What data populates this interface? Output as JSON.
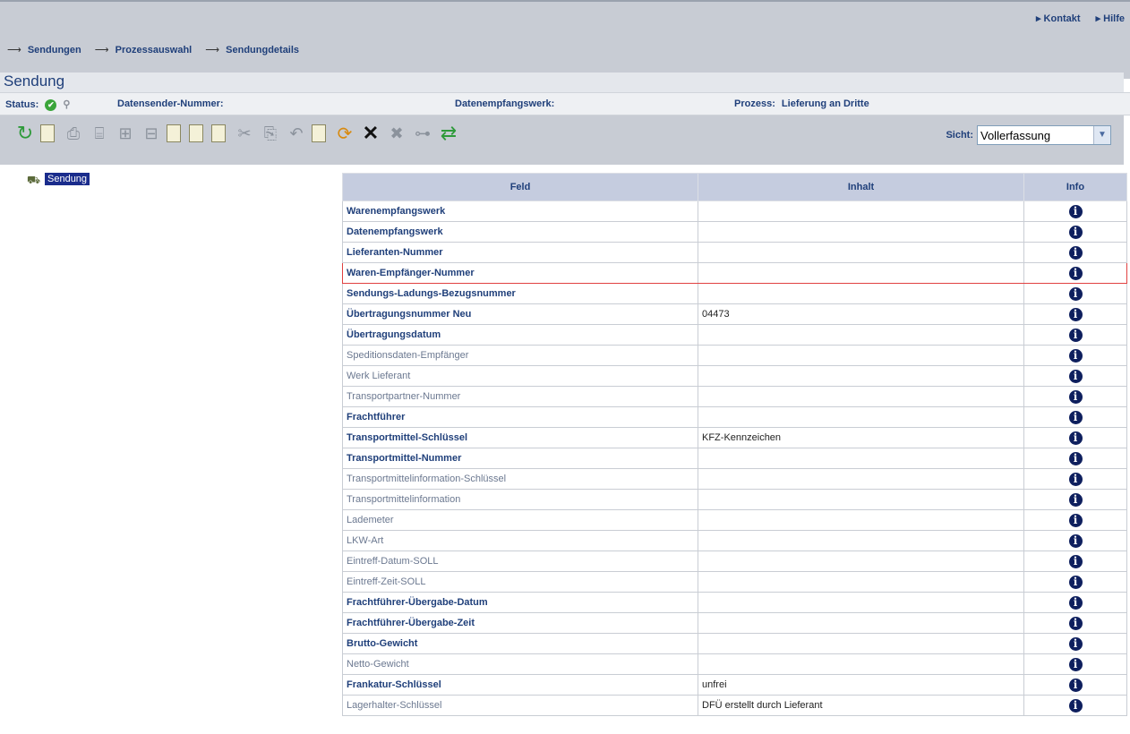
{
  "top_links": [
    "▸ Kontakt",
    "▸ Hilfe"
  ],
  "breadcrumb": [
    "Sendungen",
    "Prozessauswahl",
    "Sendungdetails"
  ],
  "title": "Sendung",
  "status": {
    "label": "Status:",
    "datensender_label": "Datensender-Nummer:",
    "datenempfangswerk_label": "Datenempfangswerk:",
    "prozess_label": "Prozess:",
    "prozess_value": "Lieferung an Dritte"
  },
  "view": {
    "label": "Sicht:",
    "value": "Vollerfassung"
  },
  "tree": {
    "root": "Sendung"
  },
  "table": {
    "headers": [
      "Feld",
      "Inhalt",
      "Info"
    ],
    "rows": [
      {
        "field": "Warenempfangswerk",
        "value": "",
        "bold": true
      },
      {
        "field": "Datenempfangswerk",
        "value": "",
        "bold": true
      },
      {
        "field": "Lieferanten-Nummer",
        "value": "",
        "bold": true
      },
      {
        "field": "Waren-Empfänger-Nummer",
        "value": "",
        "bold": true,
        "highlight": true
      },
      {
        "field": "Sendungs-Ladungs-Bezugsnummer",
        "value": "",
        "bold": true
      },
      {
        "field": "Übertragungsnummer Neu",
        "value": "04473",
        "bold": true
      },
      {
        "field": "Übertragungsdatum",
        "value": "",
        "bold": true
      },
      {
        "field": "Speditionsdaten-Empfänger",
        "value": "",
        "bold": false
      },
      {
        "field": "Werk Lieferant",
        "value": "",
        "bold": false
      },
      {
        "field": "Transportpartner-Nummer",
        "value": "",
        "bold": false
      },
      {
        "field": "Frachtführer",
        "value": "",
        "bold": true
      },
      {
        "field": "Transportmittel-Schlüssel",
        "value": "KFZ-Kennzeichen",
        "bold": true
      },
      {
        "field": "Transportmittel-Nummer",
        "value": "",
        "bold": true
      },
      {
        "field": "Transportmittelinformation-Schlüssel",
        "value": "",
        "bold": false
      },
      {
        "field": "Transportmittelinformation",
        "value": "",
        "bold": false
      },
      {
        "field": "Lademeter",
        "value": "",
        "bold": false
      },
      {
        "field": "LKW-Art",
        "value": "",
        "bold": false
      },
      {
        "field": "Eintreff-Datum-SOLL",
        "value": "",
        "bold": false
      },
      {
        "field": "Eintreff-Zeit-SOLL",
        "value": "",
        "bold": false
      },
      {
        "field": "Frachtführer-Übergabe-Datum",
        "value": "",
        "bold": true
      },
      {
        "field": "Frachtführer-Übergabe-Zeit",
        "value": "",
        "bold": true
      },
      {
        "field": "Brutto-Gewicht",
        "value": "",
        "bold": true
      },
      {
        "field": "Netto-Gewicht",
        "value": "",
        "bold": false
      },
      {
        "field": "Frankatur-Schlüssel",
        "value": "unfrei",
        "bold": true
      },
      {
        "field": "Lagerhalter-Schlüssel",
        "value": "DFÜ erstellt durch Lieferant",
        "bold": false
      }
    ]
  }
}
